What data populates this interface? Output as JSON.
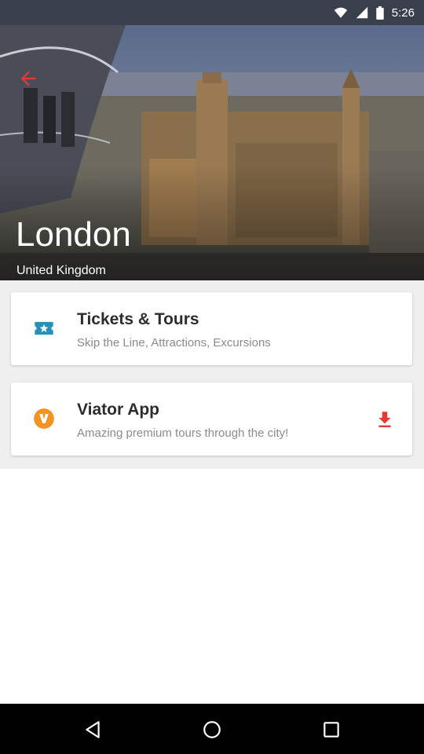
{
  "status_bar": {
    "time": "5:26"
  },
  "hero": {
    "city": "London",
    "country": "United Kingdom"
  },
  "cards": [
    {
      "title": "Tickets & Tours",
      "subtitle": "Skip the Line, Attractions, Excursions",
      "icon": "ticket-star-icon",
      "icon_color": "#2a8fb8"
    },
    {
      "title": "Viator App",
      "subtitle": "Amazing premium tours through the city!",
      "icon": "viator-logo-icon",
      "icon_color": "#f29422",
      "action_icon": "download-icon",
      "action_color": "#e53935"
    }
  ],
  "colors": {
    "back_arrow": "#e53935",
    "status_bar": "#3a3f4c",
    "content_bg": "#efefef"
  },
  "nav": {
    "back": "back-triangle-icon",
    "home": "home-circle-icon",
    "recents": "recents-square-icon"
  }
}
